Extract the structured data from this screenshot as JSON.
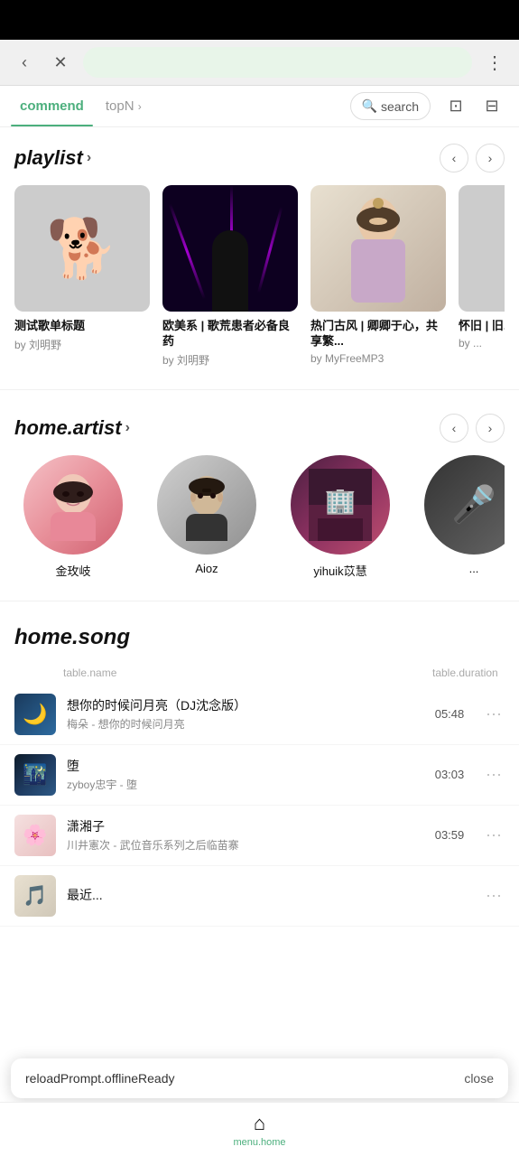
{
  "statusBar": {
    "background": "#000000"
  },
  "browserChrome": {
    "backLabel": "‹",
    "closeLabel": "✕",
    "urlBarText": "",
    "moreLabel": "⋮"
  },
  "tabs": [
    {
      "id": "commend",
      "label": "commend",
      "active": true
    },
    {
      "id": "topN",
      "label": "topN",
      "active": false
    }
  ],
  "searchBar": {
    "icon": "🔍",
    "placeholder": "search"
  },
  "iconHistory": "⊡",
  "iconDisplay": "⊟",
  "playlist": {
    "title": "playlist",
    "chevron": "›",
    "cards": [
      {
        "id": "card1",
        "coverType": "dog",
        "title": "测试歌单标题",
        "author": "by 刘明野"
      },
      {
        "id": "card2",
        "coverType": "purple",
        "title": "欧美系 | 歌荒患者必备良药",
        "author": "by 刘明野"
      },
      {
        "id": "card3",
        "coverType": "girl-ancient",
        "title": "热门古风 | 卿卿于心，共享繁...",
        "author": "by MyFreeMP3"
      },
      {
        "id": "card4",
        "coverType": "partial",
        "title": "怀旧 | 旧...",
        "author": "by ..."
      }
    ]
  },
  "artist": {
    "title": "home.artist",
    "chevron": "›",
    "artists": [
      {
        "id": "a1",
        "avatarType": "girl1",
        "name": "金玫岐"
      },
      {
        "id": "a2",
        "avatarType": "guy",
        "name": "Aioz"
      },
      {
        "id": "a3",
        "avatarType": "dusk",
        "name": "yihuik苡慧"
      },
      {
        "id": "a4",
        "avatarType": "partial",
        "name": "..."
      }
    ]
  },
  "songs": {
    "title": "home.song",
    "tableHeader": {
      "name": "table.name",
      "duration": "table.duration"
    },
    "rows": [
      {
        "id": "s1",
        "thumbType": "moon",
        "title": "想你的时候问月亮（DJ沈念版）",
        "artist": "梅朵 - 想你的时候问月亮",
        "duration": "05:48"
      },
      {
        "id": "s2",
        "thumbType": "fall",
        "title": "堕",
        "artist": "zyboy忠宇 - 堕",
        "duration": "03:03"
      },
      {
        "id": "s3",
        "thumbType": "xiao",
        "title": "潇湘子",
        "artist": "川井憲次 - 武位音乐系列之后临苗寨",
        "duration": "03:59"
      },
      {
        "id": "s4",
        "thumbType": "recent",
        "title": "最近...",
        "artist": "",
        "duration": ""
      }
    ]
  },
  "toast": {
    "text": "reloadPrompt.offlineReady",
    "closeLabel": "close"
  },
  "bottomNav": [
    {
      "id": "home",
      "icon": "⌂",
      "label": "menu.home",
      "active": true
    }
  ]
}
